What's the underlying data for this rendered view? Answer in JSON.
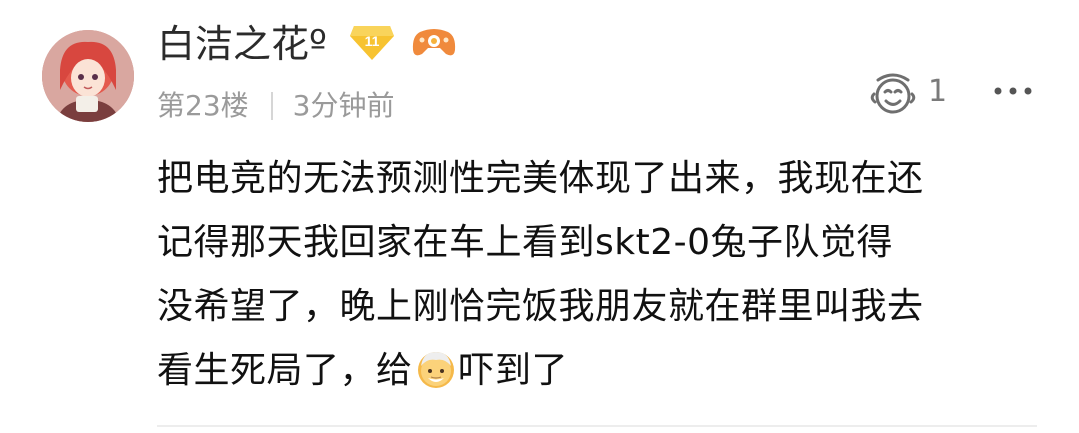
{
  "comment": {
    "username": "白洁之花º",
    "level_badge": "11",
    "floor": "第23楼",
    "time_ago": "3分钟前",
    "like_count": "1",
    "content_lines": [
      "把电竞的无法预测性完美体现了出来，我现在还",
      "记得那天我回家在车上看到skt2‐0兔子队觉得",
      "没希望了，晚上刚恰完饭我朋友就在群里叫我去"
    ],
    "content_last_before_emoji": "看生死局了，给",
    "content_last_after_emoji": "吓到了"
  },
  "icons": {
    "avatar": "anime-girl-avatar",
    "level_badge_icon": "level-diamond-icon",
    "game_badge_icon": "gamepad-icon",
    "like_icon": "like-face-icon",
    "more_icon": "more-dots-icon",
    "inline_emoji": "old-man-emoji"
  },
  "colors": {
    "username": "#2b2b2b",
    "meta": "#9a9a9a",
    "badge_gold": "#f5b51e",
    "game_badge": "#f08a3c",
    "text": "#111111"
  }
}
